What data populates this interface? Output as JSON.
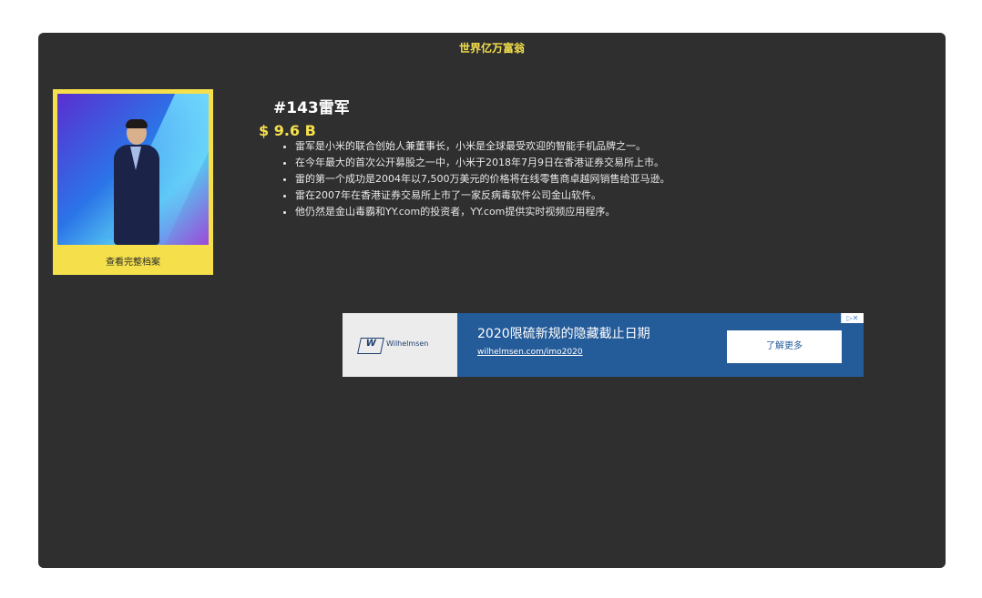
{
  "page": {
    "header_title": "世界亿万富翁"
  },
  "profile": {
    "view_full_profile_label": "查看完整档案",
    "name": "#143雷军",
    "net_worth": "$ 9.6 B",
    "facts": [
      "雷军是小米的联合创始人兼董事长，小米是全球最受欢迎的智能手机品牌之一。",
      "在今年最大的首次公开募股之一中，小米于2018年7月9日在香港证券交易所上市。",
      "雷的第一个成功是2004年以7,500万美元的价格将在线零售商卓越网销售给亚马逊。",
      "雷在2007年在香港证券交易所上市了一家反病毒软件公司金山软件。",
      "他仍然是金山毒霸和YY.com的投资者，YY.com提供实时视频应用程序。"
    ]
  },
  "ad": {
    "brand": "Wilhelmsen",
    "logo_letter": "W",
    "headline": "2020限硫新规的隐藏截止日期",
    "url": "wilhelmsen.com/imo2020",
    "cta_label": "了解更多",
    "close_label": "▷✕"
  },
  "colors": {
    "card_background": "#2f2f2f",
    "accent_yellow": "#f5e04c",
    "ad_blue": "#245b99"
  }
}
